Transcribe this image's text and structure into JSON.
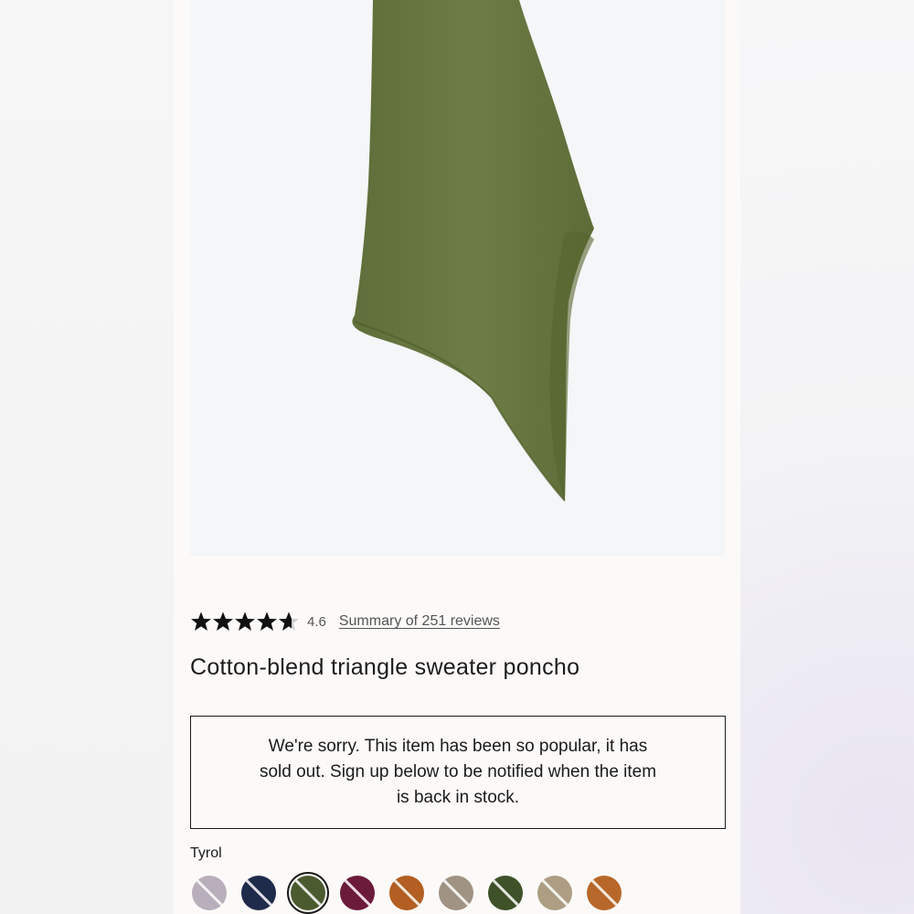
{
  "product": {
    "title": "Cotton-blend triangle sweater poncho",
    "image_alt": "Olive green triangle sweater poncho"
  },
  "rating": {
    "value": "4.6",
    "stars_filled": 4.6,
    "reviews_link": "Summary of 251 reviews"
  },
  "availability": {
    "message": "We're sorry. This item has been so popular, it has sold out. Sign up below to be notified when the item is back in stock."
  },
  "colors": {
    "selected_label": "Tyrol",
    "selected_index": 2,
    "swatches": [
      {
        "hex": "#b9aebb"
      },
      {
        "hex": "#1e2a4a"
      },
      {
        "hex": "#4b5a2f"
      },
      {
        "hex": "#6c1a3a"
      },
      {
        "hex": "#b35e22"
      },
      {
        "hex": "#a09383"
      },
      {
        "hex": "#3f5128"
      },
      {
        "hex": "#ad9e83"
      },
      {
        "hex": "#b8672a"
      }
    ]
  },
  "theme": {
    "poncho_color": "#6b7a45",
    "poncho_shadow": "#5b6a37",
    "text_color": "#1a1a1a"
  }
}
